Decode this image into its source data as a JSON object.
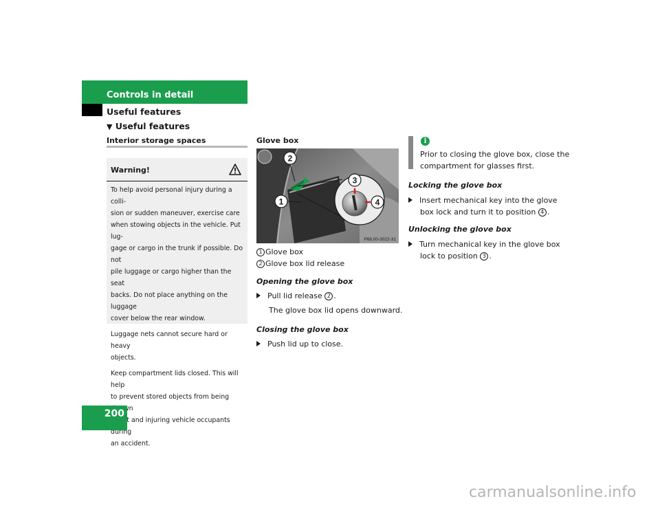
{
  "header": {
    "chapter": "Controls in detail",
    "section": "Useful features",
    "subsection": "Useful features"
  },
  "left": {
    "heading": "Interior storage spaces",
    "warning": {
      "title": "Warning!",
      "icon": "warning-triangle-icon",
      "paragraphs": [
        "To help avoid personal injury during a colli-",
        "sion or sudden maneuver, exercise care",
        "when stowing objects in the vehicle. Put lug-",
        "gage or cargo in the trunk if possible. Do not",
        "pile luggage or cargo higher than the seat",
        "backs. Do not place anything on the luggage",
        "cover below the rear window."
      ],
      "p2": [
        "Luggage nets cannot secure hard or heavy",
        "objects."
      ],
      "p3": [
        "Keep compartment lids closed. This will help",
        "to prevent stored objects from being thrown",
        "about and injuring vehicle occupants during",
        "an accident."
      ]
    }
  },
  "middle": {
    "heading": "Glove box",
    "figure": {
      "code": "P68.00-3022-31",
      "callouts": [
        "1",
        "2",
        "3",
        "4"
      ]
    },
    "legend": [
      {
        "num": "1",
        "text": "Glove box"
      },
      {
        "num": "2",
        "text": "Glove box lid release"
      }
    ],
    "opening": {
      "title": "Opening the glove box",
      "step_before": "Pull lid release",
      "step_num": "2",
      "step_after": ".",
      "result": "The glove box lid opens downward."
    },
    "closing": {
      "title": "Closing the glove box",
      "step": "Push lid up to close."
    }
  },
  "right": {
    "info": {
      "icon": "info-icon",
      "lines": [
        "Prior to closing the glove box, close the",
        "compartment for glasses first."
      ]
    },
    "locking": {
      "title": "Locking the glove box",
      "line1": "Insert mechanical key into the glove",
      "line2_before": "box lock and turn it to position",
      "num": "4",
      "line2_after": "."
    },
    "unlocking": {
      "title": "Unlocking the glove box",
      "line1": "Turn mechanical key in the glove box",
      "line2_before": "lock to position",
      "num": "3",
      "line2_after": "."
    }
  },
  "page_number": "200",
  "watermark": "carmanualsonline.info",
  "colors": {
    "brand_green": "#1a9e4e",
    "warning_bg": "#efefef"
  }
}
